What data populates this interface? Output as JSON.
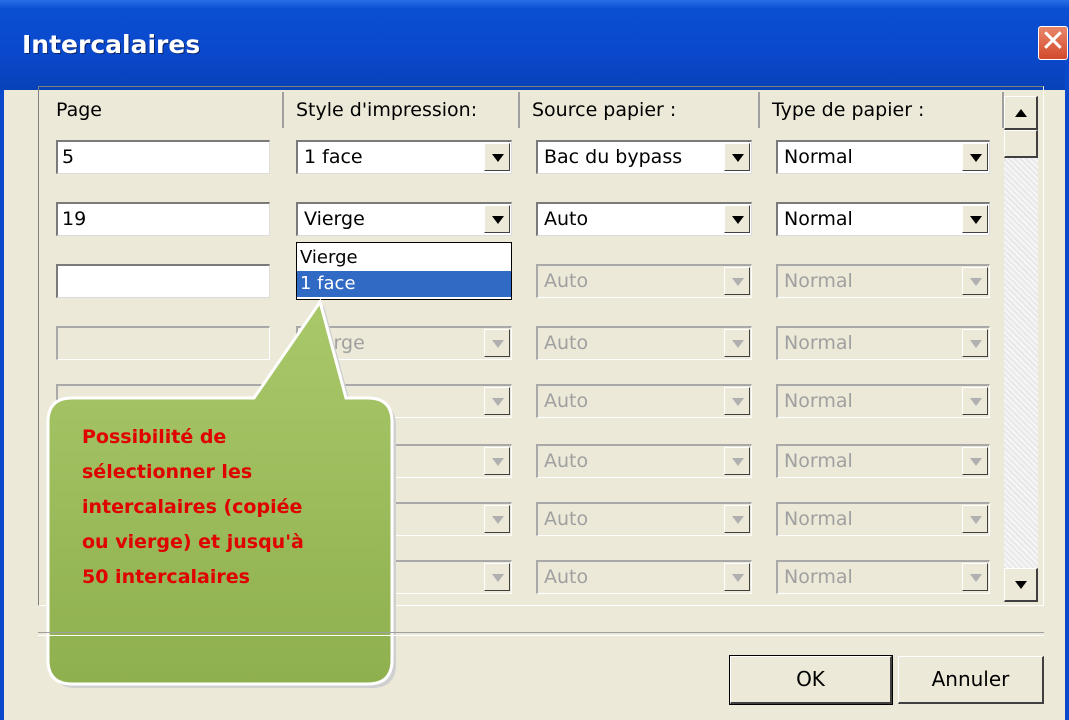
{
  "window": {
    "title": "Intercalaires",
    "close_glyph": "✕"
  },
  "columns": [
    "Page",
    "Style d'impression:",
    "Source papier :",
    "Type de papier :"
  ],
  "rows": [
    {
      "page": "5",
      "style": "1 face",
      "source": "Bac du bypass",
      "type": "Normal",
      "enabled": true
    },
    {
      "page": "19",
      "style": "Vierge",
      "source": "Auto",
      "type": "Normal",
      "enabled": true
    },
    {
      "page": "",
      "style": "",
      "source": "Auto",
      "type": "Normal",
      "enabled": "partial"
    },
    {
      "page": "",
      "style": "Vierge",
      "source": "Auto",
      "type": "Normal",
      "enabled": false
    },
    {
      "page": "",
      "style": "",
      "source": "Auto",
      "type": "Normal",
      "enabled": false
    },
    {
      "page": "",
      "style": "",
      "source": "Auto",
      "type": "Normal",
      "enabled": false
    },
    {
      "page": "",
      "style": "",
      "source": "Auto",
      "type": "Normal",
      "enabled": false
    },
    {
      "page": "",
      "style": "",
      "source": "Auto",
      "type": "Normal",
      "enabled": false
    }
  ],
  "dropdown": {
    "options": [
      "Vierge",
      "1 face"
    ],
    "selected": "1 face"
  },
  "callout": {
    "lines": [
      "Possibilité de",
      "sélectionner les",
      "intercalaires (copiée",
      "ou vierge) et jusqu'à",
      "50 intercalaires"
    ],
    "color": "#e00000",
    "fill": "#9bbb59"
  },
  "buttons": {
    "ok": "OK",
    "cancel": "Annuler"
  },
  "icons": [
    "close-icon",
    "scroll-up-arrow-icon",
    "scroll-down-arrow-icon",
    "dropdown-arrow-icon"
  ]
}
